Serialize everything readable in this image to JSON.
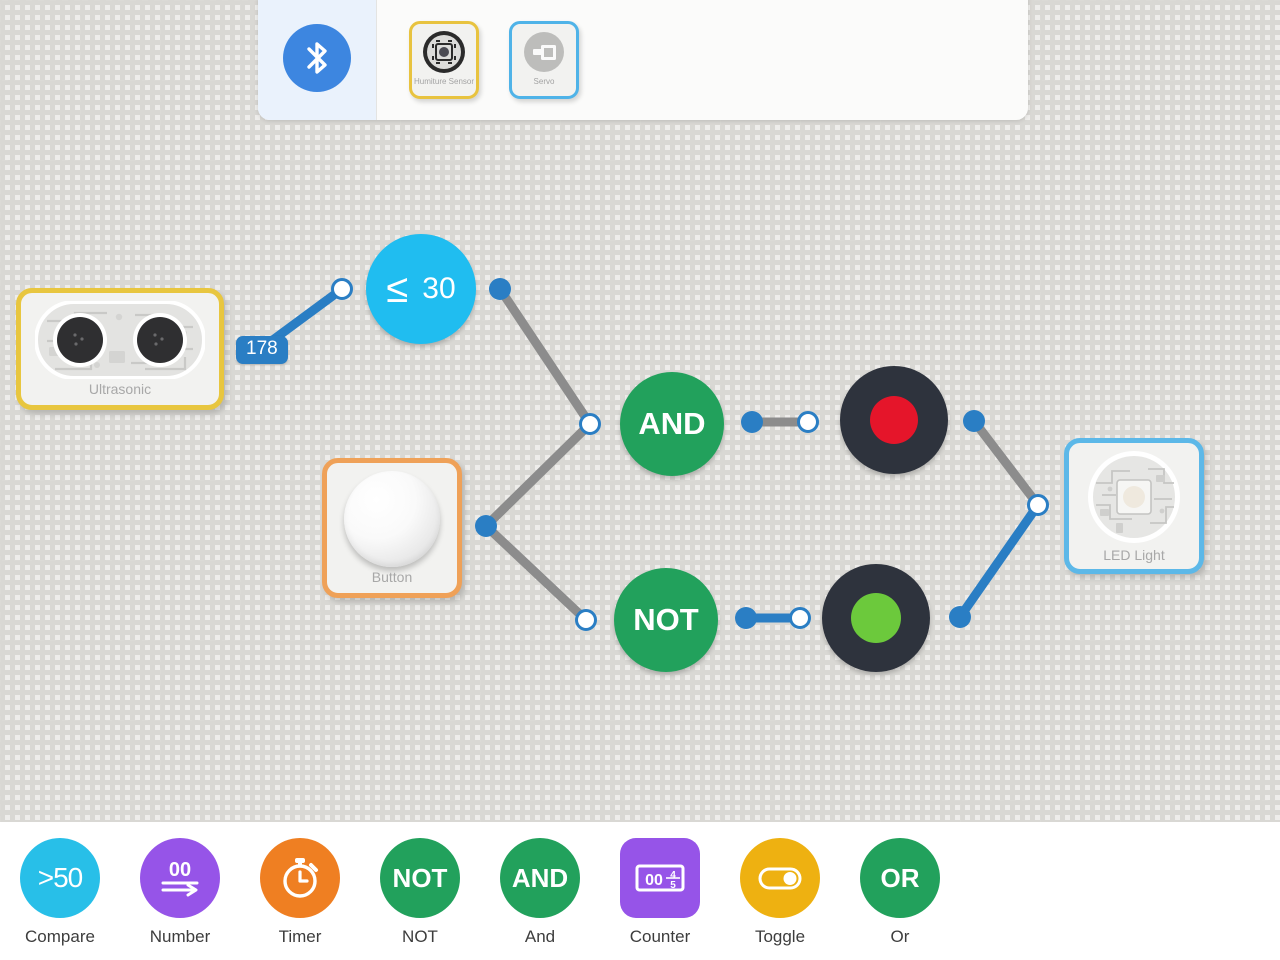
{
  "topbar": {
    "bluetooth_icon": "bluetooth-icon",
    "devices": [
      {
        "label": "Humiture Sensor",
        "icon": "humiture-sensor-icon",
        "accent": "#e8c33f",
        "selected": true
      },
      {
        "label": "Servo",
        "icon": "servo-icon",
        "accent": "#4fb3e8",
        "selected": true
      }
    ]
  },
  "canvas": {
    "blocks": [
      {
        "id": "ultrasonic",
        "label": "Ultrasonic",
        "icon": "ultrasonic-sensor-icon",
        "border_color": "#e8c63f",
        "value": "178"
      },
      {
        "id": "button",
        "label": "Button",
        "icon": "push-button-icon",
        "border_color": "#efa158"
      },
      {
        "id": "led",
        "label": "LED Light",
        "icon": "led-light-icon",
        "border_color": "#5cb8e8"
      }
    ],
    "nodes": [
      {
        "id": "compare",
        "type": "compare",
        "operator": "≤",
        "value": "30",
        "color": "#20bdf0"
      },
      {
        "id": "and",
        "type": "logic",
        "label": "AND",
        "color": "#22a15c"
      },
      {
        "id": "not",
        "type": "logic",
        "label": "NOT",
        "color": "#22a15c"
      },
      {
        "id": "indicator-red",
        "type": "indicator",
        "state": "off",
        "bulb_color": "#e5152a",
        "body_color": "#2e333d"
      },
      {
        "id": "indicator-green",
        "type": "indicator",
        "state": "on",
        "bulb_color": "#6cc93c",
        "body_color": "#2e333d"
      }
    ],
    "wire_colors": {
      "active": "#2a7ec4",
      "inactive": "#8c8c8c",
      "port_fill": "#2a7ec4",
      "port_empty": "#ffffff"
    }
  },
  "palette": {
    "items": [
      {
        "label": "Compare",
        "icon": "compare-icon",
        "glyph": ">50",
        "color": "#28bfe8",
        "shape": "circle"
      },
      {
        "label": "Number",
        "icon": "number-icon",
        "glyph": "00",
        "color": "#9654e8",
        "shape": "circle"
      },
      {
        "label": "Timer",
        "icon": "timer-icon",
        "glyph": "",
        "color": "#ef7f22",
        "shape": "circle"
      },
      {
        "label": "NOT",
        "icon": "not-gate-icon",
        "glyph": "NOT",
        "color": "#22a15c",
        "shape": "circle"
      },
      {
        "label": "And",
        "icon": "and-gate-icon",
        "glyph": "AND",
        "color": "#22a15c",
        "shape": "circle"
      },
      {
        "label": "Counter",
        "icon": "counter-icon",
        "glyph": "00",
        "color": "#9654e8",
        "shape": "square"
      },
      {
        "label": "Toggle",
        "icon": "toggle-icon",
        "glyph": "",
        "color": "#eeb111",
        "shape": "circle"
      },
      {
        "label": "Or",
        "icon": "or-gate-icon",
        "glyph": "OR",
        "color": "#22a15c",
        "shape": "circle"
      }
    ]
  }
}
